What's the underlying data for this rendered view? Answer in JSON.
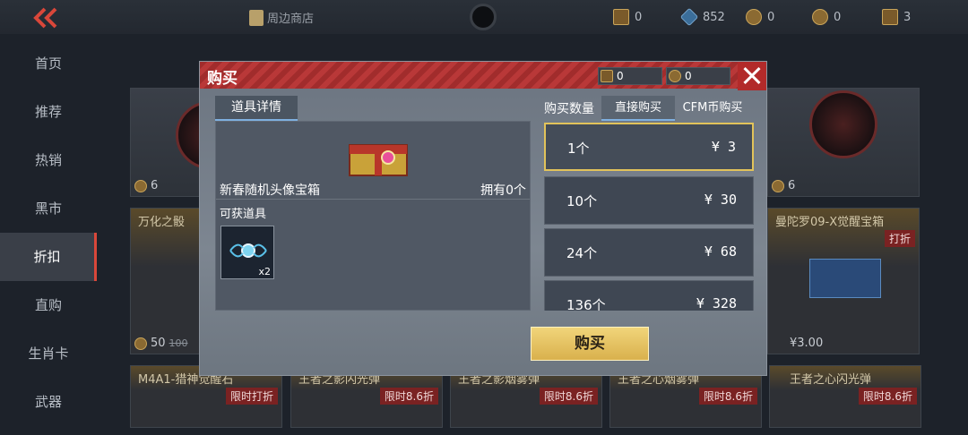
{
  "topbar": {
    "shop_label": "周边商店",
    "currencies": [
      "0",
      "852",
      "0",
      "0",
      "3"
    ]
  },
  "sidebar": {
    "items": [
      "首页",
      "推荐",
      "热销",
      "黑市",
      "折扣",
      "直购",
      "生肖卡",
      "武器"
    ],
    "active_index": 4
  },
  "cards": {
    "row1_left_price": "6",
    "row1_right_price": "6",
    "row2_left_title": "万化之骰",
    "row2_left_price": "50",
    "row2_left_old_price": "100",
    "row2_right_title": "曼陀罗09-X觉醒宝箱",
    "row2_right_tag": "打折",
    "row2_right_price": "¥3.00",
    "row3": [
      {
        "title": "M4A1-猎神觉醒石",
        "tag": "限时打折"
      },
      {
        "title": "王者之影闪光弹",
        "tag": "限时8.6折"
      },
      {
        "title": "王者之影烟雾弹",
        "tag": "限时8.6折"
      },
      {
        "title": "王者之心烟雾弹",
        "tag": "限时8.6折"
      },
      {
        "title": "王者之心闪光弹",
        "tag": "限时8.6折"
      }
    ]
  },
  "modal": {
    "title": "购买",
    "currency_a": "0",
    "currency_b": "0",
    "detail_tab": "道具详情",
    "item_name": "新春随机头像宝箱",
    "owned": "拥有0个",
    "obtain_label": "可获道具",
    "reward_count": "x2",
    "qty_label": "购买数量",
    "tabs": [
      "直接购买",
      "CFM币购买"
    ],
    "options": [
      {
        "qty": "1个",
        "price": "¥ 3"
      },
      {
        "qty": "10个",
        "price": "¥ 30"
      },
      {
        "qty": "24个",
        "price": "¥ 68"
      },
      {
        "qty": "136个",
        "price": "¥ 328"
      }
    ],
    "selected_option": 0,
    "buy_label": "购买"
  }
}
